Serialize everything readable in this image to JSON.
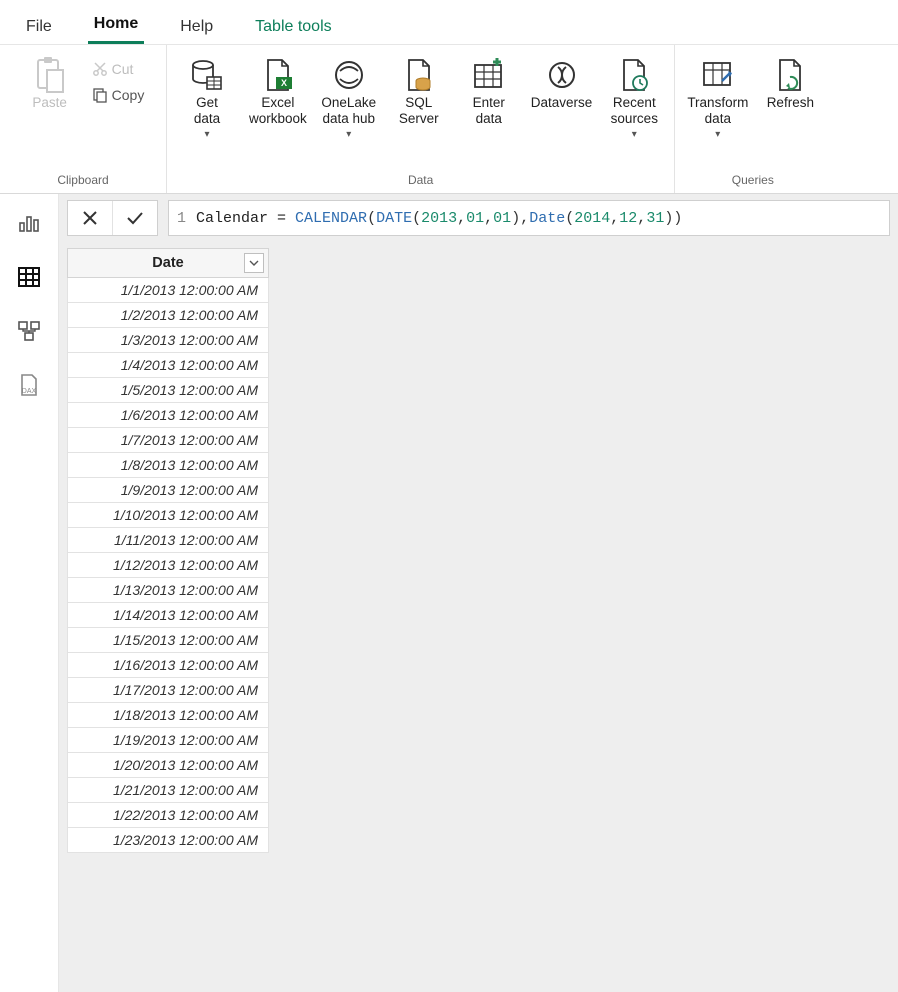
{
  "tabs": {
    "file": "File",
    "home": "Home",
    "help": "Help",
    "tools": "Table tools"
  },
  "ribbon": {
    "clipboard": {
      "paste": "Paste",
      "cut": "Cut",
      "copy": "Copy",
      "group": "Clipboard"
    },
    "data": {
      "get": "Get\ndata",
      "excel": "Excel\nworkbook",
      "onelake": "OneLake\ndata hub",
      "sql": "SQL\nServer",
      "enter": "Enter\ndata",
      "dataverse": "Dataverse",
      "recent": "Recent\nsources",
      "group": "Data"
    },
    "queries": {
      "transform": "Transform\ndata",
      "refresh": "Refresh",
      "group": "Queries"
    }
  },
  "formula": {
    "line": "1",
    "tokens": [
      {
        "t": "plain",
        "v": "Calendar = "
      },
      {
        "t": "kw",
        "v": "CALENDAR"
      },
      {
        "t": "pun",
        "v": "("
      },
      {
        "t": "kw",
        "v": "DATE"
      },
      {
        "t": "pun",
        "v": "("
      },
      {
        "t": "num",
        "v": "2013"
      },
      {
        "t": "pun",
        "v": ","
      },
      {
        "t": "num",
        "v": "01"
      },
      {
        "t": "pun",
        "v": ","
      },
      {
        "t": "num",
        "v": "01"
      },
      {
        "t": "pun",
        "v": ")"
      },
      {
        "t": "pun",
        "v": ","
      },
      {
        "t": "kw",
        "v": "Date"
      },
      {
        "t": "pun",
        "v": "("
      },
      {
        "t": "num",
        "v": "2014"
      },
      {
        "t": "pun",
        "v": ","
      },
      {
        "t": "num",
        "v": "12"
      },
      {
        "t": "pun",
        "v": ","
      },
      {
        "t": "num",
        "v": "31"
      },
      {
        "t": "pun",
        "v": ")"
      },
      {
        "t": "pun",
        "v": ")"
      }
    ]
  },
  "table": {
    "header": "Date",
    "rows": [
      "1/1/2013 12:00:00 AM",
      "1/2/2013 12:00:00 AM",
      "1/3/2013 12:00:00 AM",
      "1/4/2013 12:00:00 AM",
      "1/5/2013 12:00:00 AM",
      "1/6/2013 12:00:00 AM",
      "1/7/2013 12:00:00 AM",
      "1/8/2013 12:00:00 AM",
      "1/9/2013 12:00:00 AM",
      "1/10/2013 12:00:00 AM",
      "1/11/2013 12:00:00 AM",
      "1/12/2013 12:00:00 AM",
      "1/13/2013 12:00:00 AM",
      "1/14/2013 12:00:00 AM",
      "1/15/2013 12:00:00 AM",
      "1/16/2013 12:00:00 AM",
      "1/17/2013 12:00:00 AM",
      "1/18/2013 12:00:00 AM",
      "1/19/2013 12:00:00 AM",
      "1/20/2013 12:00:00 AM",
      "1/21/2013 12:00:00 AM",
      "1/22/2013 12:00:00 AM",
      "1/23/2013 12:00:00 AM"
    ]
  }
}
